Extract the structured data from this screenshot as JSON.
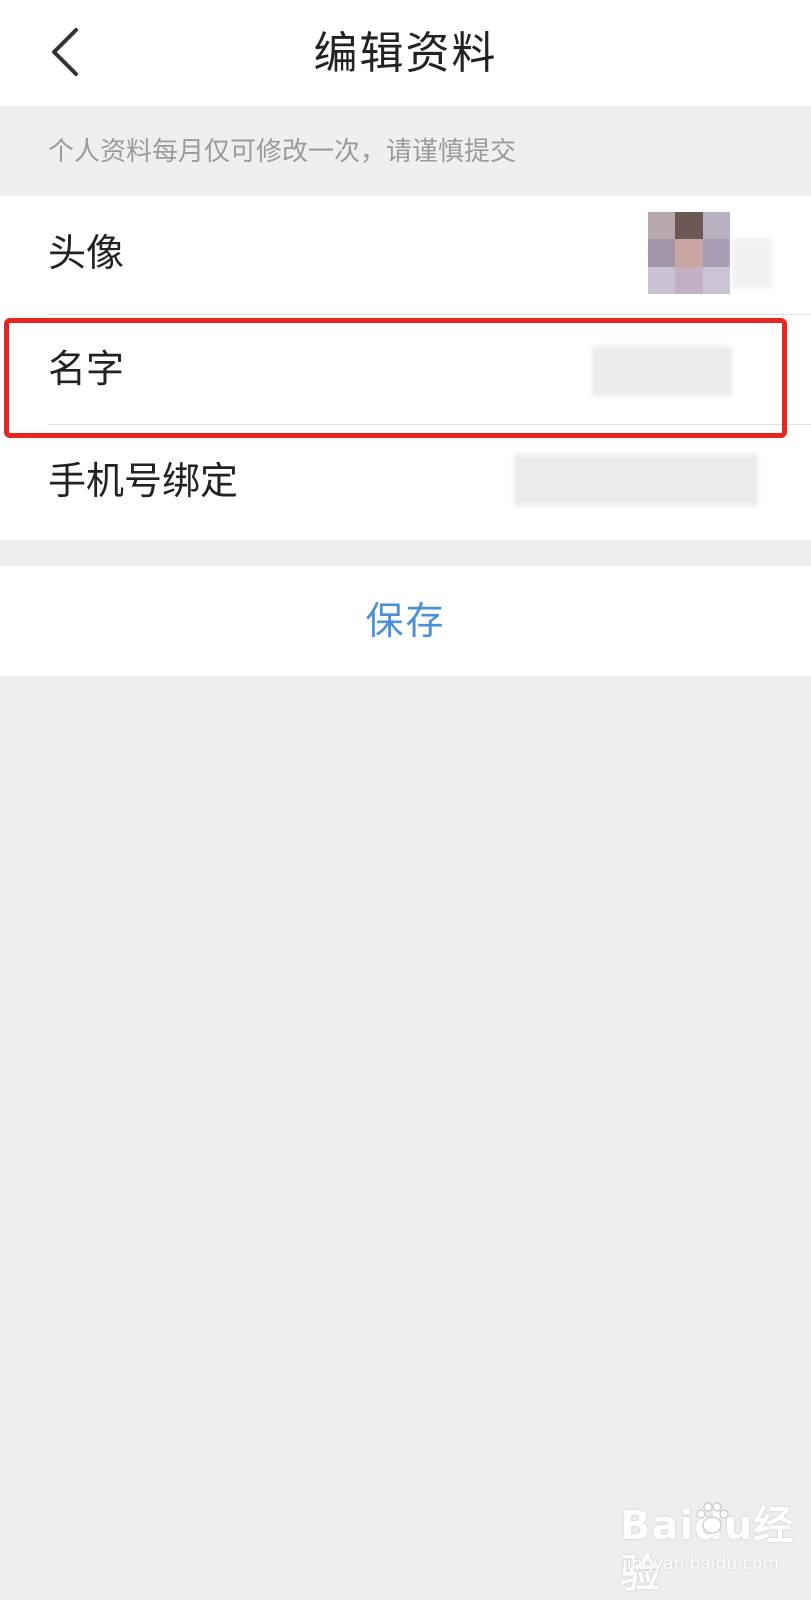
{
  "header": {
    "title": "编辑资料",
    "back_icon": "chevron-left-icon"
  },
  "notice": {
    "text": "个人资料每月仅可修改一次，请谨慎提交"
  },
  "form": {
    "rows": [
      {
        "label": "头像",
        "value_type": "avatar-image-pixelated"
      },
      {
        "label": "名字",
        "value_type": "name-text-blurred",
        "highlighted": true
      },
      {
        "label": "手机号绑定",
        "value_type": "phone-number-blurred"
      }
    ]
  },
  "actions": {
    "save_label": "保存"
  },
  "colors": {
    "accent": "#4a90d9",
    "highlight_border": "#e8261f",
    "background": "#eeeeee",
    "notice_text": "#9b9b9b"
  },
  "watermark": {
    "logo": "Baidu经验",
    "url": "jingyan.baidu.com"
  }
}
